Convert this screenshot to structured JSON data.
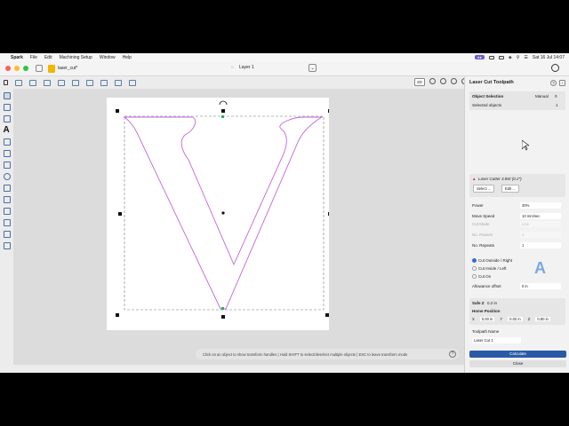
{
  "menubar": {
    "items": [
      "Spark",
      "File",
      "Edit",
      "Machining Setup",
      "Window",
      "Help"
    ],
    "badge": "",
    "datetime": "Sat 16 Jul  14:07"
  },
  "titlebar": {
    "document_name": "laser_cut*",
    "layer": "Layer 1"
  },
  "toolbar": {
    "view_2d": "2D"
  },
  "canvas": {
    "status_hint": "Click on an object to show transform handles | Hold SHIFT to select/deselect multiple objects | ESC to leave transform mode",
    "help": "?"
  },
  "panel": {
    "title": "Laser Cut Toolpath",
    "help": "?",
    "object_selection": {
      "label": "Object Selection",
      "mode": "Manual",
      "mode_value": "0",
      "selected_label": "Selected objects",
      "selected_count": "1"
    },
    "tool": {
      "name": "Laser Cutter 3.8W (0.2\")",
      "select_label": "Select ...",
      "edit_label": "Edit ..."
    },
    "params": [
      {
        "label": "Power",
        "value": "30%",
        "dim": false
      },
      {
        "label": "Move Speed",
        "value": "10 mm/sec",
        "dim": false
      },
      {
        "label": "Cut Mode",
        "value": "Line",
        "dim": true
      },
      {
        "label": "No. Passes",
        "value": "1",
        "dim": true
      },
      {
        "label": "No. Repeats",
        "value": "1",
        "dim": false
      }
    ],
    "cut_options": [
      {
        "label": "Cut Outside / Right",
        "selected": true
      },
      {
        "label": "Cut Inside / Left",
        "selected": false
      },
      {
        "label": "Cut On",
        "selected": false
      }
    ],
    "allowance_label": "Allowance offset",
    "allowance_value": "0 in",
    "safe_z_label": "Safe Z",
    "safe_z_value": "0.2 in",
    "home_label": "Home Position",
    "home": {
      "x_label": "X",
      "x": "0.00 in",
      "y_label": "Y",
      "y": "0.00 in",
      "z_label": "Z",
      "z": "0.80 in"
    },
    "toolpath_name_label": "Toolpath Name",
    "toolpath_name": "Laser Cut 1",
    "calculate_label": "Calculate",
    "close_label": "Close"
  },
  "colors": {
    "accent": "#2a5aa6",
    "vector_outline": "#c266d9",
    "traffic_red": "#ff5f57",
    "traffic_yellow": "#febc2e",
    "traffic_green": "#28c840"
  }
}
